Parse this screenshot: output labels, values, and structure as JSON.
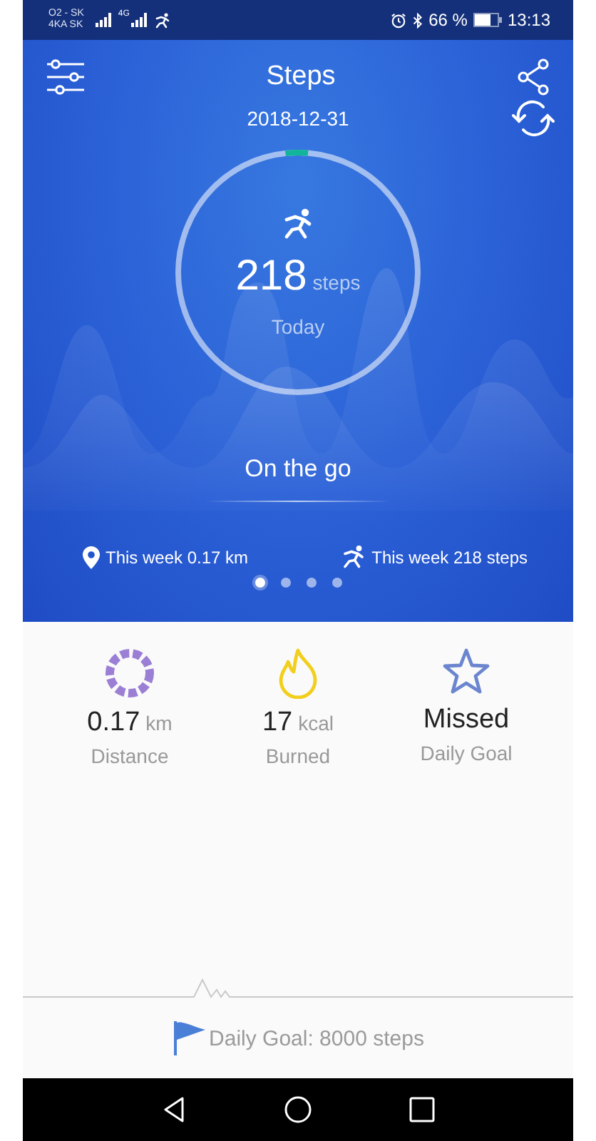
{
  "status_bar": {
    "carrier_1": "O2 - SK",
    "carrier_2": "4KA SK",
    "network": "4G",
    "battery": "66 %",
    "time": "13:13"
  },
  "header": {
    "title": "Steps",
    "date": "2018-12-31"
  },
  "ring": {
    "level": 0.03,
    "count": "218",
    "unit": "steps",
    "caption": "Today"
  },
  "activity": "On the go",
  "week": [
    {
      "kind": "distance",
      "text": "This week 0.17 km"
    },
    {
      "kind": "steps",
      "text": "This week 218 steps"
    }
  ],
  "pages": [
    {
      "selected": true
    },
    {
      "selected": false
    },
    {
      "selected": false
    },
    {
      "selected": false
    }
  ],
  "stats": [
    {
      "kind": "distance",
      "value": "0.17",
      "unit": "km",
      "label": "Distance"
    },
    {
      "kind": "calories",
      "value": "17",
      "unit": "kcal",
      "label": "Burned"
    },
    {
      "kind": "goal",
      "value": "Missed",
      "label": "Daily Goal"
    }
  ],
  "daily_goal": "Daily Goal: 8000 steps"
}
